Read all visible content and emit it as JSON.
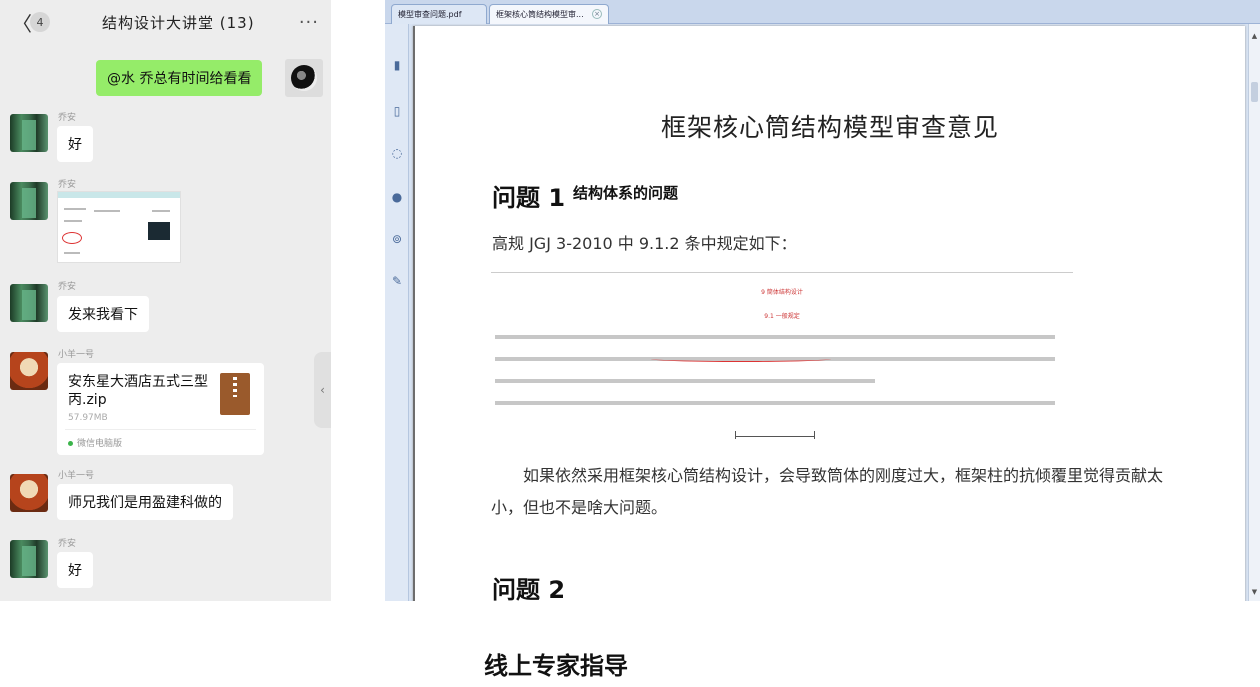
{
  "chat": {
    "back_glyph": "〈",
    "unread_count": "4",
    "title": "结构设计大讲堂 (13)",
    "more_glyph": "···",
    "messages": {
      "m1_text": "@水 乔总有时间给看看",
      "m2_sender": "乔安",
      "m2_text": "好",
      "m3_sender": "乔安",
      "m4_sender": "乔安",
      "m4_text": "发来我看下",
      "m5_sender": "小羊一号",
      "m6_sender": "小羊一号",
      "m6_text": "师兄我们是用盈建科做的",
      "m7_sender": "乔安",
      "m7_text": "好"
    },
    "file": {
      "name": "安东星大酒店五式三型丙.zip",
      "size": "57.97MB",
      "source": "微信电脑版"
    },
    "collapse_glyph": "‹"
  },
  "viewer": {
    "tabs": [
      "模型审查问题.pdf",
      "框架核心筒结构模型审..."
    ],
    "tab_close_glyph": "×",
    "rail_icons": [
      "page-icon",
      "document-icon",
      "comment-icon",
      "tag-icon",
      "attachment-icon",
      "sign-icon"
    ],
    "rail_glyphs": [
      "▮",
      "▯",
      "◌",
      "●",
      "⊚",
      "✎"
    ],
    "scroll_up": "▲",
    "scroll_down": "▼",
    "doc": {
      "title": "框架核心筒结构模型审查意见",
      "q1_label": "问题 1",
      "q1_subtitle": "结构体系的问题",
      "q1_line": "高规 JGJ 3-2010 中 9.1.2 条中规定如下：",
      "excerpt_heading1": "9 筒体结构设计",
      "excerpt_heading2": "9.1 一般规定",
      "paragraph": "如果依然采用框架核心筒结构设计，会导致筒体的刚度过大，框架柱的抗倾覆里觉得贡献太小，但也不是啥大问题。",
      "q2_label": "问题 2"
    }
  },
  "caption": "线上专家指导"
}
